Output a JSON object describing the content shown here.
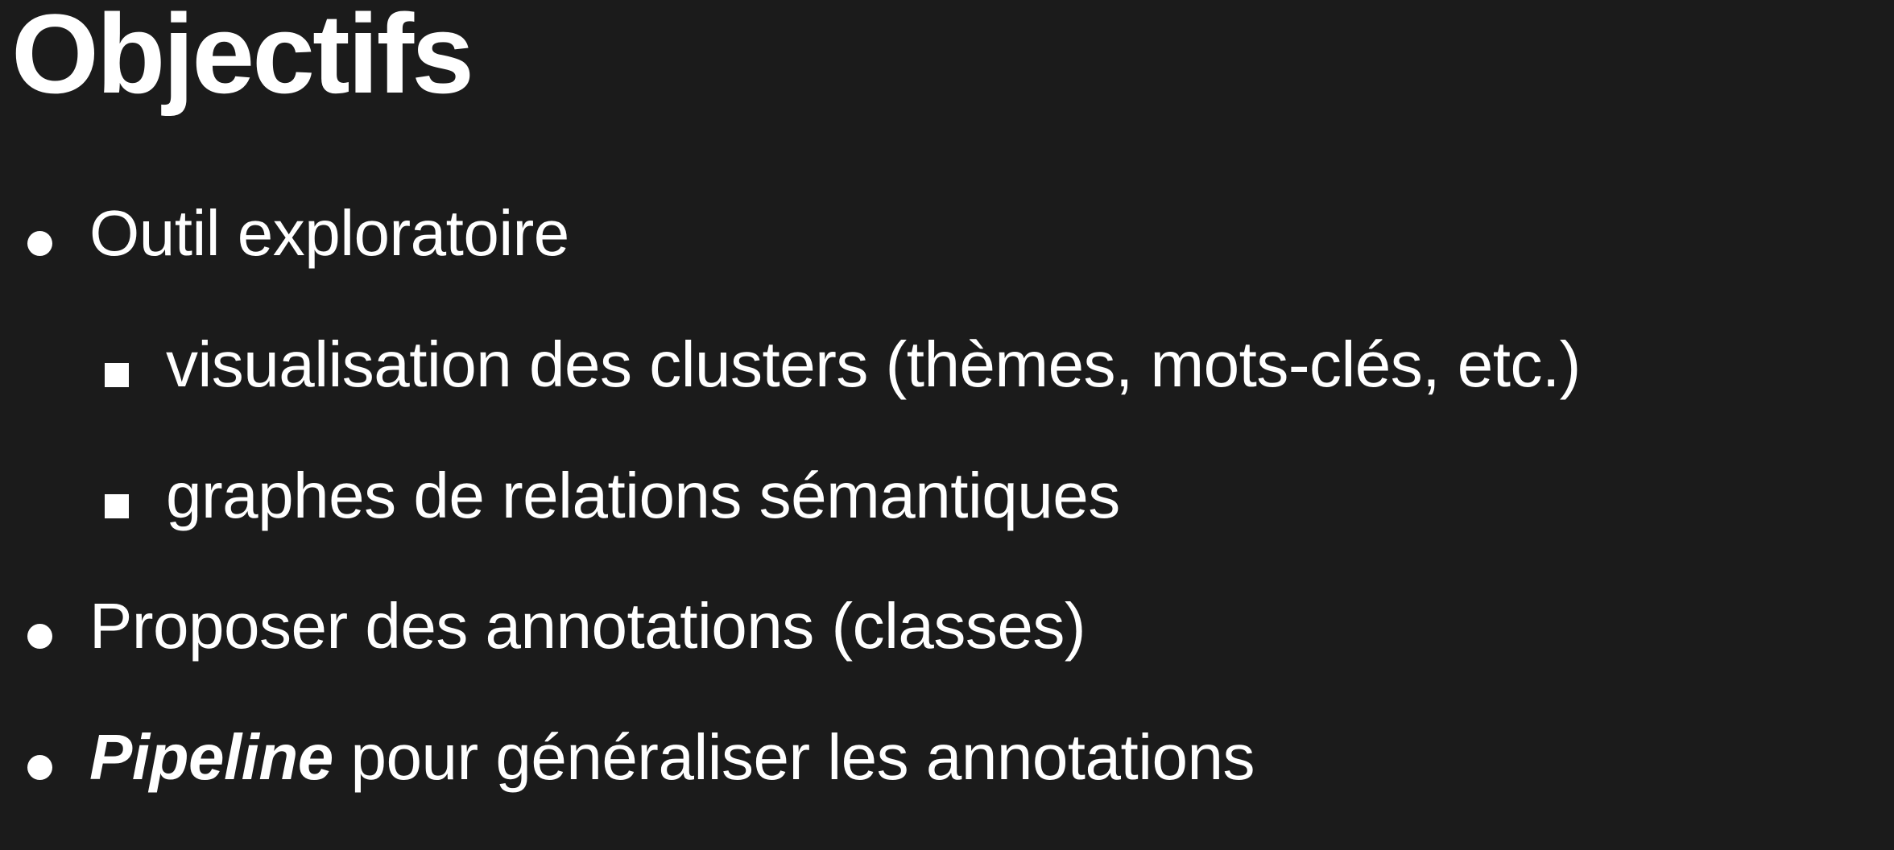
{
  "slide": {
    "title": "Objectifs",
    "bullets": [
      {
        "level": 1,
        "text": "Outil exploratoire"
      },
      {
        "level": 2,
        "text": "visualisation des clusters (thèmes, mots-clés, etc.)"
      },
      {
        "level": 2,
        "text": "graphes de relations sémantiques"
      },
      {
        "level": 1,
        "text": "Proposer des annotations (classes)"
      },
      {
        "level": 1,
        "emphasis": "Pipeline",
        "text": " pour généraliser les annotations"
      }
    ]
  },
  "colors": {
    "background": "#1b1b1b",
    "text": "#ffffff"
  }
}
